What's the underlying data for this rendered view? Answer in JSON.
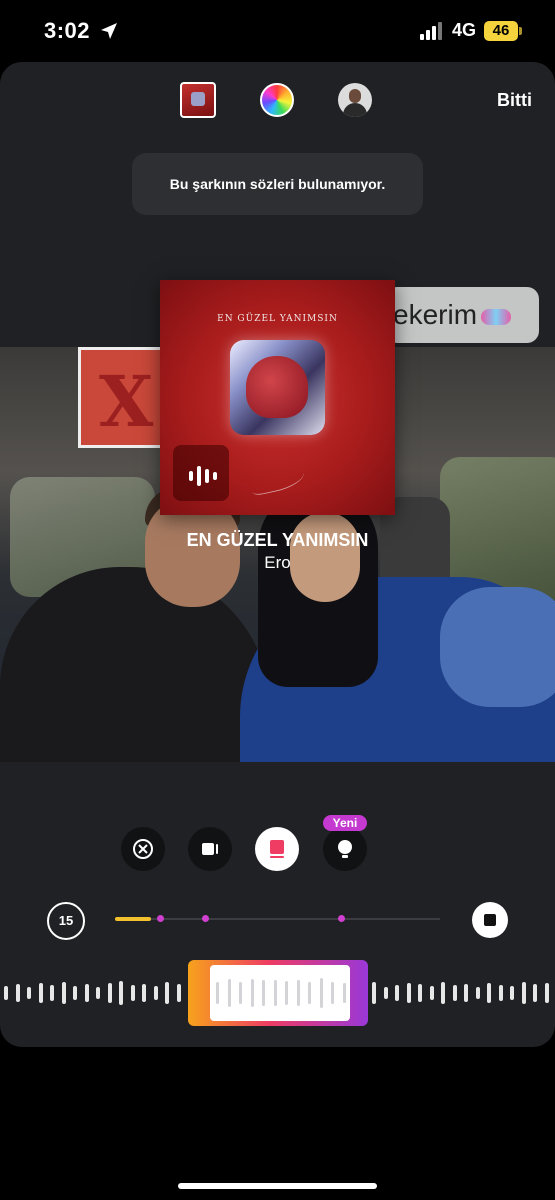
{
  "status_bar": {
    "time": "3:02",
    "network": "4G",
    "battery": "46"
  },
  "header": {
    "done_label": "Bitti"
  },
  "toast": {
    "message": "Bu şarkının sözleri bulunamıyor."
  },
  "sticker": {
    "text": "ekerim"
  },
  "album": {
    "cover_text": "EN GÜZEL YANIMSIN"
  },
  "song": {
    "title": "EN GÜZEL YANIMSIN",
    "artist": "Ero"
  },
  "controls": {
    "items": [
      {
        "name": "remove-icon"
      },
      {
        "name": "video-icon"
      },
      {
        "name": "album-card-icon",
        "active": true
      },
      {
        "name": "light-icon"
      }
    ],
    "new_badge": "Yeni"
  },
  "timeline": {
    "duration": "15",
    "progress_fraction": 0.11
  },
  "colors": {
    "accent_yellow": "#f4c12e",
    "accent_pink": "#d040d0",
    "badge": "#c43ad0"
  }
}
